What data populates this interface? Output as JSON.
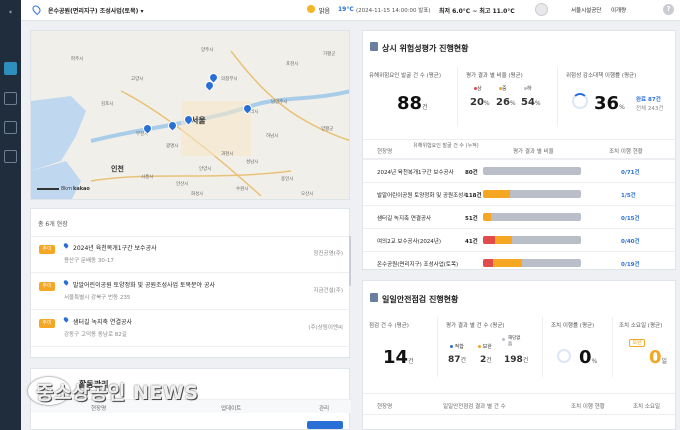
{
  "colors": {
    "accent": "#2a6fd6",
    "orange": "#f5a623",
    "red": "#e04b4b",
    "gray": "#b9bec8",
    "yellow": "#f2c744"
  },
  "header": {
    "project": "온수공원(면리지구) 조성사업(토목)",
    "weather": "맑음",
    "temp": "19°C",
    "date": "(2024-11-15 14:00:00 발표)",
    "temp_range": "최저 6.0°C ~ 최고 11.0°C",
    "org": "서울시설공단",
    "user": "이개량",
    "help_icon": "question-icon"
  },
  "map": {
    "labels": {
      "seoul": "서울",
      "incheon": "인천"
    },
    "scale": "8km",
    "provider": "kakao",
    "city_labels": [
      "파주시",
      "양주시",
      "의정부시",
      "포천시",
      "남양주시",
      "구리시",
      "하남시",
      "광명시",
      "시흥시",
      "안산시",
      "수원시",
      "용인시",
      "성남시",
      "안양시",
      "과천시",
      "부천시",
      "김포시",
      "고양시",
      "양평군",
      "가평군",
      "화성시",
      "오산시"
    ]
  },
  "sites": {
    "count_label": "총 6개 현장",
    "items": [
      {
        "tag": "추이",
        "name": "2024년 육천복개1구간 보수공사",
        "addr": "용산구 문배동 30-17",
        "company": "정진공영(주)"
      },
      {
        "tag": "추이",
        "name": "발알어린이공원 토양정화 및 공원조성사업 토목분야 공사",
        "addr": "서울특별시 강북구 번동 235",
        "company": "지금건설(주)"
      },
      {
        "tag": "추이",
        "name": "샘터길 녹지축 연결공사",
        "addr": "강동구 고덕동 동남로 82길",
        "company": "(주)상림이엔씨"
      }
    ]
  },
  "activity": {
    "title": "활동관리",
    "cols": [
      "현장명",
      "업데이트",
      "관리"
    ]
  },
  "risk": {
    "title": "상시 위험성평가 진행현황",
    "kpi1": {
      "label": "유해위험요인 발굴 건 수 (평균)",
      "value": "88",
      "unit": "건"
    },
    "kpi2": {
      "label": "평가 결과 별 비율 (평균)",
      "high_label": "상",
      "mid_label": "중",
      "low_label": "하",
      "high": "20",
      "mid": "26",
      "low": "54",
      "pct": "%"
    },
    "kpi3": {
      "label": "위험성 감소대책 이행률 (평균)",
      "value": "36",
      "pct": "%",
      "done": "완료 87건",
      "total": "전체 243건"
    },
    "cols": [
      "현장명",
      "유해위험요인 발굴 건 수 (누적)",
      "평가 결과 별 비율",
      "조치 이행 현황"
    ],
    "rows": [
      {
        "site": "2024년 육천복개1구간 보수공사",
        "count": "80건",
        "high": 0.0,
        "mid": 0.0,
        "low": 1.0,
        "action": "0/71건"
      },
      {
        "site": "발알어린이공원 토양정화 및 공원조성사업",
        "count": "118건",
        "high": 0.0,
        "mid": 0.28,
        "low": 0.72,
        "action": "1/5건"
      },
      {
        "site": "샘터길 녹지축 연결공사",
        "count": "51건",
        "high": 0.0,
        "mid": 0.08,
        "low": 0.92,
        "action": "0/15건"
      },
      {
        "site": "여의2교 보수공사(2024년)",
        "count": "41건",
        "high": 0.12,
        "mid": 0.18,
        "low": 0.7,
        "action": "0/40건"
      },
      {
        "site": "온수공원(면리지구) 조성사업(토목)",
        "count": "",
        "high": 0.1,
        "mid": 0.3,
        "low": 0.6,
        "action": "0/19건"
      }
    ]
  },
  "inspect": {
    "title": "일일안전점검 진행현황",
    "kpi1": {
      "label": "점검 건 수 (평균)",
      "value": "14",
      "unit": "건"
    },
    "kpi2": {
      "label": "평가 결과 별 건 수 (평균)",
      "ok_label": "적합",
      "warn_label": "보완",
      "na_label": "해당없음",
      "ok": "87",
      "warn": "2",
      "na": "198",
      "unit": "건"
    },
    "kpi3": {
      "label": "조치 이행률 (평균)",
      "value": "0",
      "pct": "%"
    },
    "kpi4": {
      "label": "조치 소요일 (평균)",
      "badge": "보완",
      "value": "0",
      "unit": "일"
    },
    "cols": [
      "현장명",
      "일일안전점검 결과 별 건 수",
      "조치 이행 현황",
      "조치 소요일"
    ]
  },
  "watermark": "중소상공인 NEWS"
}
